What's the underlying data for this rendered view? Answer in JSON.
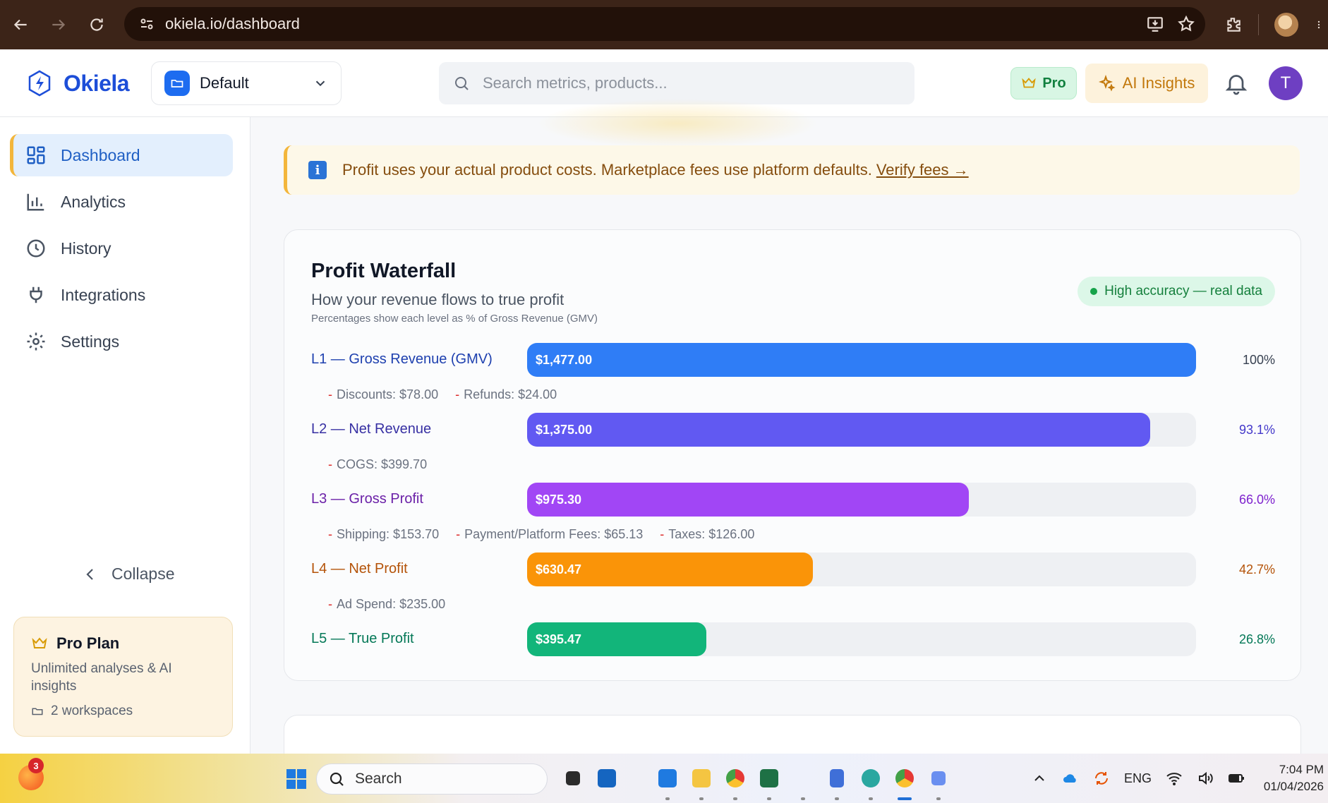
{
  "browser": {
    "url": "okiela.io/dashboard"
  },
  "header": {
    "brand": "Okiela",
    "workspace": "Default",
    "search_placeholder": "Search metrics, products...",
    "pro_badge": "Pro",
    "ai_button": "AI Insights",
    "avatar_initial": "T"
  },
  "sidebar": {
    "items": [
      {
        "label": "Dashboard",
        "icon": "dashboard-grid-icon",
        "active": true
      },
      {
        "label": "Analytics",
        "icon": "bar-chart-icon"
      },
      {
        "label": "History",
        "icon": "clock-icon"
      },
      {
        "label": "Integrations",
        "icon": "plug-icon"
      },
      {
        "label": "Settings",
        "icon": "gear-icon"
      }
    ],
    "collapse_label": "Collapse",
    "plan": {
      "title": "Pro Plan",
      "description": "Unlimited analyses & AI insights",
      "workspaces": "2 workspaces"
    }
  },
  "banner": {
    "text": "Profit uses your actual product costs. Marketplace fees use platform defaults.",
    "link": "Verify fees →"
  },
  "waterfall": {
    "title": "Profit Waterfall",
    "subtitle": "How your revenue flows to true profit",
    "note": "Percentages show each level as % of Gross Revenue (GMV)",
    "accuracy_badge": "High accuracy — real data",
    "levels": [
      {
        "label": "L1 — Gross Revenue (GMV)",
        "value": "$1,477.00",
        "pct": "100%",
        "fraction": 1.0,
        "color": "#2f7df6",
        "label_color": "#1e40af",
        "pct_color": "#374151"
      },
      {
        "label": "L2 — Net Revenue",
        "value": "$1,375.00",
        "pct": "93.1%",
        "fraction": 0.931,
        "color": "#6159f2",
        "label_color": "#3730a3",
        "pct_color": "#4338ca"
      },
      {
        "label": "L3 — Gross Profit",
        "value": "$975.30",
        "pct": "66.0%",
        "fraction": 0.66,
        "color": "#a146f5",
        "label_color": "#6b21a8",
        "pct_color": "#7e22ce"
      },
      {
        "label": "L4 — Net Profit",
        "value": "$630.47",
        "pct": "42.7%",
        "fraction": 0.427,
        "color": "#fa9408",
        "label_color": "#b45309",
        "pct_color": "#b45309"
      },
      {
        "label": "L5 — True Profit",
        "value": "$395.47",
        "pct": "26.8%",
        "fraction": 0.268,
        "color": "#12b57a",
        "label_color": "#047857",
        "pct_color": "#047857"
      }
    ],
    "deductions": [
      [
        "Discounts: $78.00",
        "Refunds: $24.00"
      ],
      [
        "COGS: $399.70"
      ],
      [
        "Shipping: $153.70",
        "Payment/Platform Fees: $65.13",
        "Taxes: $126.00"
      ],
      [
        "Ad Spend: $235.00"
      ]
    ]
  },
  "taskbar": {
    "notification_count": "3",
    "search_label": "Search",
    "language": "ENG",
    "time": "7:04 PM",
    "date": "01/04/2026"
  }
}
